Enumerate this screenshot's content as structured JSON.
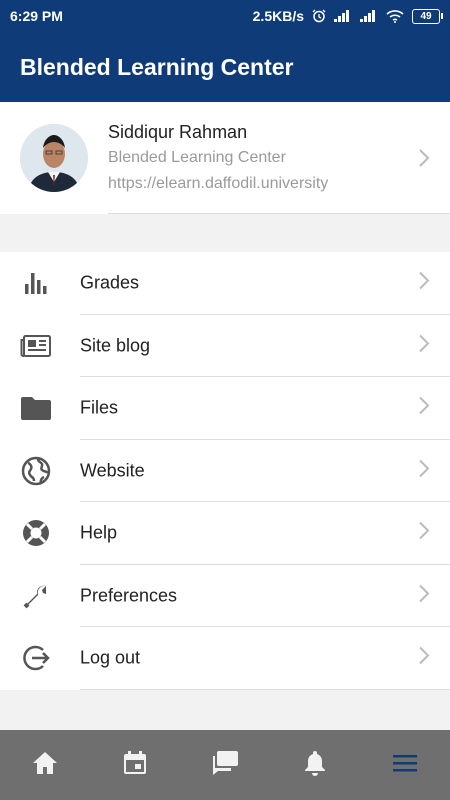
{
  "status_bar": {
    "time": "6:29 PM",
    "network_speed": "2.5KB/s",
    "battery": "49",
    "icons": [
      "alarm-icon",
      "signal-icon",
      "signal-icon",
      "wifi-icon",
      "battery-icon"
    ]
  },
  "app_bar": {
    "title": "Blended Learning Center"
  },
  "profile": {
    "name": "Siddiqur Rahman",
    "site": "Blended Learning Center",
    "url": "https://elearn.daffodil.university"
  },
  "menu": {
    "items": [
      {
        "label": "Grades",
        "icon": "bar-chart-icon"
      },
      {
        "label": "Site blog",
        "icon": "newspaper-icon"
      },
      {
        "label": "Files",
        "icon": "folder-icon"
      },
      {
        "label": "Website",
        "icon": "globe-icon"
      },
      {
        "label": "Help",
        "icon": "lifebuoy-icon"
      },
      {
        "label": "Preferences",
        "icon": "wrench-icon"
      },
      {
        "label": "Log out",
        "icon": "logout-icon"
      }
    ]
  },
  "bottom_nav": {
    "items": [
      "home-icon",
      "calendar-icon",
      "messages-icon",
      "notifications-icon",
      "menu-icon"
    ],
    "active": "menu-icon"
  },
  "colors": {
    "brand": "#0f3c78",
    "bottom_nav_bg": "#6f6f6f",
    "active_nav": "#0f3c78",
    "icon_gray": "#555555"
  }
}
